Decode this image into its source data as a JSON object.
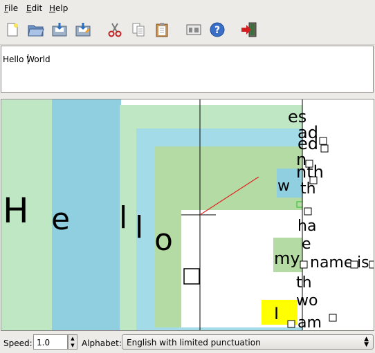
{
  "menu": {
    "file": {
      "accel": "F",
      "rest": "ile"
    },
    "edit": {
      "accel": "E",
      "rest": "dit"
    },
    "help": {
      "accel": "H",
      "rest": "elp"
    }
  },
  "toolbar": {
    "icons": [
      "new-file-icon",
      "open-folder-icon",
      "save-icon",
      "save-as-icon",
      "cut-icon",
      "copy-icon",
      "paste-icon",
      "preferences-icon",
      "help-icon",
      "quit-icon"
    ]
  },
  "editor": {
    "text": "Hello World"
  },
  "canvas": {
    "colors": {
      "green": "#bfe7c4",
      "blue": "#8fcfe0",
      "lightblue": "#a4dbe8",
      "darkgreen": "#b5dba4",
      "yellow": "#ffff00",
      "red": "#e02020"
    },
    "letters": [
      {
        "name": "letter-H",
        "text": "H"
      },
      {
        "name": "letter-e",
        "text": "e"
      },
      {
        "name": "letter-l",
        "text": "l"
      },
      {
        "name": "letter-l2",
        "text": "l"
      },
      {
        "name": "letter-o",
        "text": "o"
      }
    ],
    "right_texts": [
      {
        "name": "word-es",
        "text": "es"
      },
      {
        "name": "word-ad",
        "text": "ad"
      },
      {
        "name": "word-eds",
        "text": "ed"
      },
      {
        "name": "word-n",
        "text": "n"
      },
      {
        "name": "word-nth",
        "text": "nth"
      },
      {
        "name": "word-w",
        "text": "w"
      },
      {
        "name": "word-th",
        "text": "th"
      },
      {
        "name": "word-ha",
        "text": "ha"
      },
      {
        "name": "word-e",
        "text": "e"
      },
      {
        "name": "word-my",
        "text": "my"
      },
      {
        "name": "word-name",
        "text": "name"
      },
      {
        "name": "word-is",
        "text": "is"
      },
      {
        "name": "word-th2",
        "text": "th"
      },
      {
        "name": "word-wo",
        "text": "wo"
      },
      {
        "name": "word-I",
        "text": "I"
      },
      {
        "name": "word-am",
        "text": "am"
      }
    ]
  },
  "status": {
    "speed_label": "Speed:",
    "speed_value": "1.0",
    "alphabet_label": "Alphabet:",
    "alphabet_value": "English with limited punctuation"
  }
}
